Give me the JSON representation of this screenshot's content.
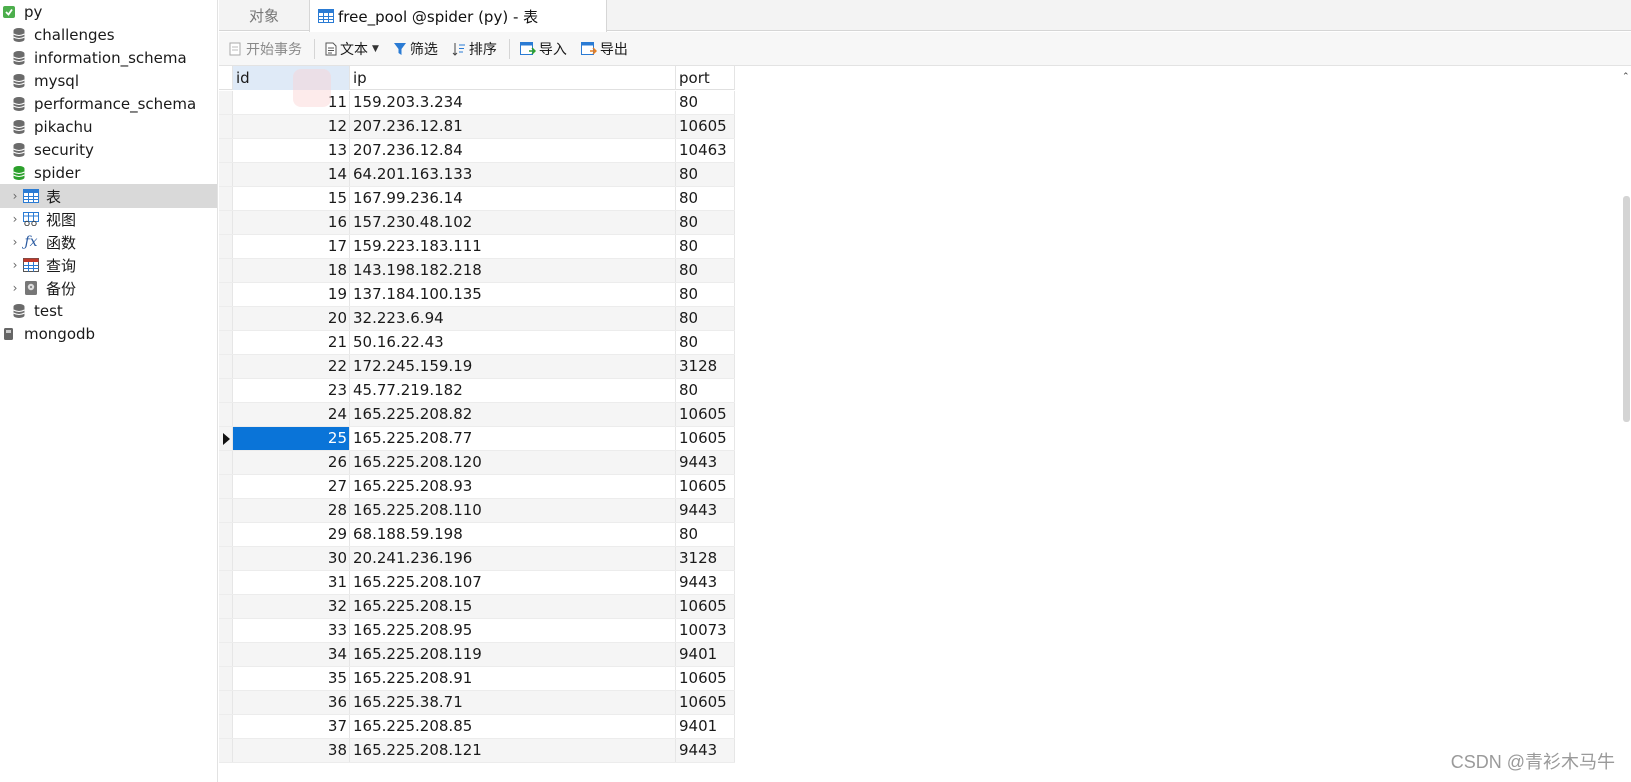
{
  "sidebar": {
    "items": [
      {
        "label": "py",
        "icon": "connection-icon"
      },
      {
        "label": "challenges",
        "icon": "database-icon"
      },
      {
        "label": "information_schema",
        "icon": "database-icon"
      },
      {
        "label": "mysql",
        "icon": "database-icon"
      },
      {
        "label": "performance_schema",
        "icon": "database-icon"
      },
      {
        "label": "pikachu",
        "icon": "database-icon"
      },
      {
        "label": "security",
        "icon": "database-icon"
      },
      {
        "label": "spider",
        "icon": "database-open-icon"
      },
      {
        "label": "表",
        "icon": "table-icon"
      },
      {
        "label": "视图",
        "icon": "view-icon"
      },
      {
        "label": "函数",
        "icon": "function-icon"
      },
      {
        "label": "查询",
        "icon": "query-icon"
      },
      {
        "label": "备份",
        "icon": "backup-icon"
      },
      {
        "label": "test",
        "icon": "database-icon"
      },
      {
        "label": "mongodb",
        "icon": "connection-icon"
      }
    ]
  },
  "tabs": {
    "objects": "对象",
    "table": "free_pool @spider (py) - 表"
  },
  "toolbar": {
    "begin_transaction": "开始事务",
    "text": "文本",
    "filter": "筛选",
    "sort": "排序",
    "import": "导入",
    "export": "导出"
  },
  "grid": {
    "columns": [
      "id",
      "ip",
      "port"
    ],
    "rows": [
      [
        "11",
        "159.203.3.234",
        "80"
      ],
      [
        "12",
        "207.236.12.81",
        "10605"
      ],
      [
        "13",
        "207.236.12.84",
        "10463"
      ],
      [
        "14",
        "64.201.163.133",
        "80"
      ],
      [
        "15",
        "167.99.236.14",
        "80"
      ],
      [
        "16",
        "157.230.48.102",
        "80"
      ],
      [
        "17",
        "159.223.183.111",
        "80"
      ],
      [
        "18",
        "143.198.182.218",
        "80"
      ],
      [
        "19",
        "137.184.100.135",
        "80"
      ],
      [
        "20",
        "32.223.6.94",
        "80"
      ],
      [
        "21",
        "50.16.22.43",
        "80"
      ],
      [
        "22",
        "172.245.159.19",
        "3128"
      ],
      [
        "23",
        "45.77.219.182",
        "80"
      ],
      [
        "24",
        "165.225.208.82",
        "10605"
      ],
      [
        "25",
        "165.225.208.77",
        "10605"
      ],
      [
        "26",
        "165.225.208.120",
        "9443"
      ],
      [
        "27",
        "165.225.208.93",
        "10605"
      ],
      [
        "28",
        "165.225.208.110",
        "9443"
      ],
      [
        "29",
        "68.188.59.198",
        "80"
      ],
      [
        "30",
        "20.241.236.196",
        "3128"
      ],
      [
        "31",
        "165.225.208.107",
        "9443"
      ],
      [
        "32",
        "165.225.208.15",
        "10605"
      ],
      [
        "33",
        "165.225.208.95",
        "10073"
      ],
      [
        "34",
        "165.225.208.119",
        "9401"
      ],
      [
        "35",
        "165.225.208.91",
        "10605"
      ],
      [
        "36",
        "165.225.38.71",
        "10605"
      ],
      [
        "37",
        "165.225.208.85",
        "9401"
      ],
      [
        "38",
        "165.225.208.121",
        "9443"
      ]
    ],
    "current_row_id": "25"
  },
  "watermark": "CSDN @青衫木马牛",
  "colors": {
    "selection": "#0a74d8",
    "db_icon": "#6b6b6b",
    "db_active_icon": "#2ca02c",
    "table_icon": "#2a7bd4"
  }
}
